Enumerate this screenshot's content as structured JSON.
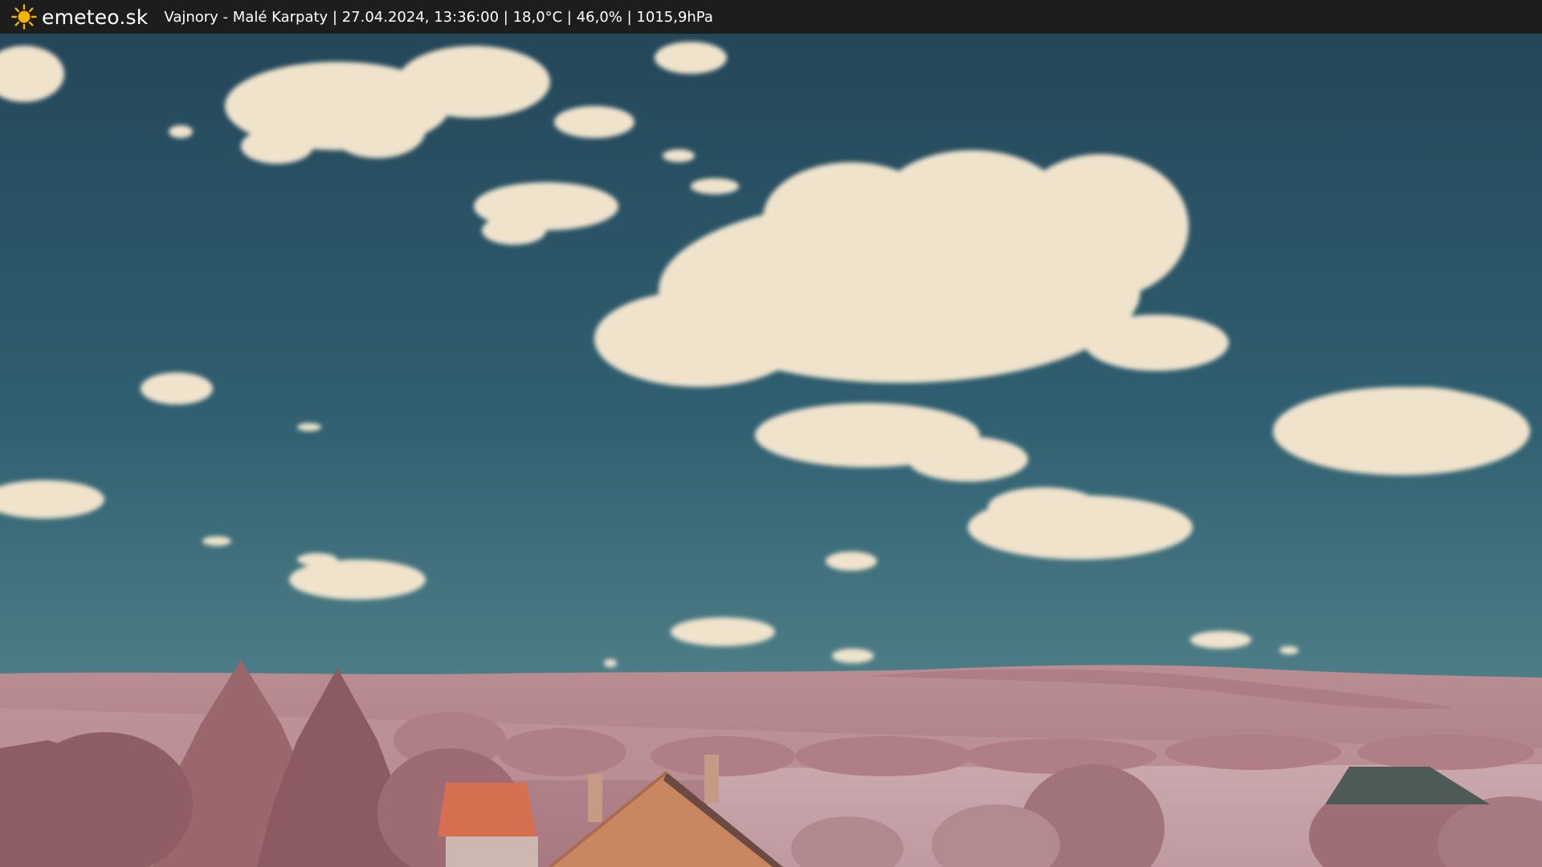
{
  "header": {
    "brand": "emeteo.sk",
    "logo_icon": "sun-icon",
    "caption": "Vajnory - Malé Karpaty | 27.04.2024, 13:36:00 | 18,0°C | 46,0% | 1015,9hPa"
  },
  "colors": {
    "bar_background": "#1d1d1d",
    "sun": "#f2b400",
    "sky_top": "#254a5e",
    "sky_bottom": "#5a8a93",
    "clouds": "#efe3cc",
    "hills": "#b8888e",
    "trees": "#9c6a70",
    "roof": "#d56f4f"
  }
}
